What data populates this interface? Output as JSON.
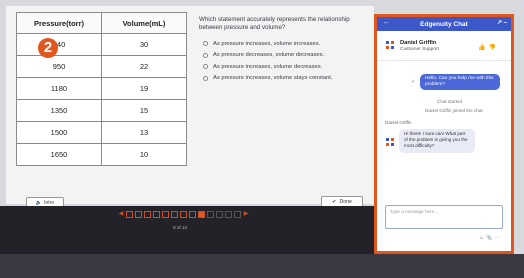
{
  "table": {
    "headers": [
      "Pressure(torr)",
      "Volume(mL)"
    ],
    "rows": [
      [
        "740",
        "30"
      ],
      [
        "950",
        "22"
      ],
      [
        "1180",
        "19"
      ],
      [
        "1350",
        "15"
      ],
      [
        "1500",
        "13"
      ],
      [
        "1650",
        "10"
      ]
    ]
  },
  "badge": "2",
  "question": "Which statement accurately represents the relationship between pressure and volume?",
  "options": [
    "As pressure increases, volume increases.",
    "As pressure decreases, volume decreases.",
    "As pressure increases, volume decreases.",
    "As pressure increases, volume stays constant."
  ],
  "buttons": {
    "intro": "Intro",
    "done": "Done"
  },
  "pager": {
    "count": "9 of 13",
    "total": 13,
    "current": 9
  },
  "chat": {
    "title": "Edgenuity Chat",
    "agent_name": "Daniel Griffin",
    "agent_role": "Customer Support",
    "user_message": "Hello. Can you help me with this problem?",
    "status_started": "Chat started",
    "status_joined": "Daniel Griffin joined the chat",
    "agent_label": "Daniel Griffin",
    "agent_message": "Hi there! I sure can! What part of the problem is giving you the most difficulty?",
    "input_placeholder": "Type a message here..."
  },
  "colors": {
    "accent": "#e0561f",
    "chat_header": "#3b57c8",
    "user_bubble": "#4a68d8"
  }
}
